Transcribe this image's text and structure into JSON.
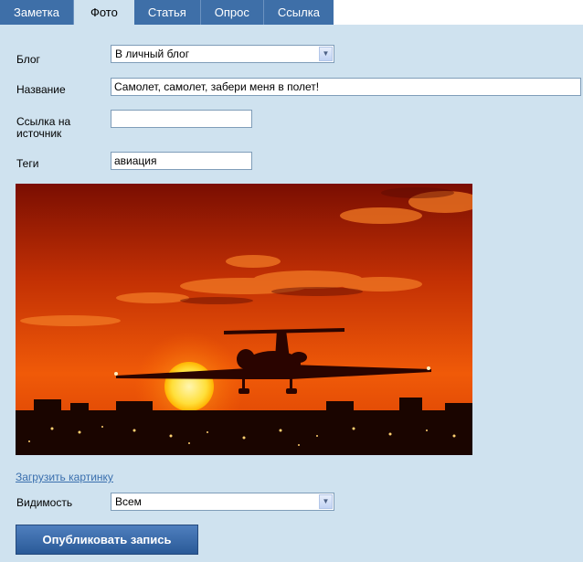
{
  "tabs": [
    "Заметка",
    "Фото",
    "Статья",
    "Опрос",
    "Ссылка"
  ],
  "form": {
    "blog_label": "Блог",
    "blog_value": "В личный блог",
    "title_label": "Название",
    "title_value": "Самолет, самолет, забери меня в полет!",
    "source_label_line1": "Ссылка на",
    "source_label_line2": "источник",
    "source_value": "",
    "tags_label": "Теги",
    "tags_value": "авиация",
    "upload_link": "Загрузить картинку",
    "visibility_label": "Видимость",
    "visibility_value": "Всем",
    "publish_button": "Опубликовать запись"
  },
  "colors": {
    "background": "#cfe2ef",
    "tab_bar": "#3e6fa8",
    "publish_button": "#3a6aaa",
    "link": "#3a6fae"
  }
}
